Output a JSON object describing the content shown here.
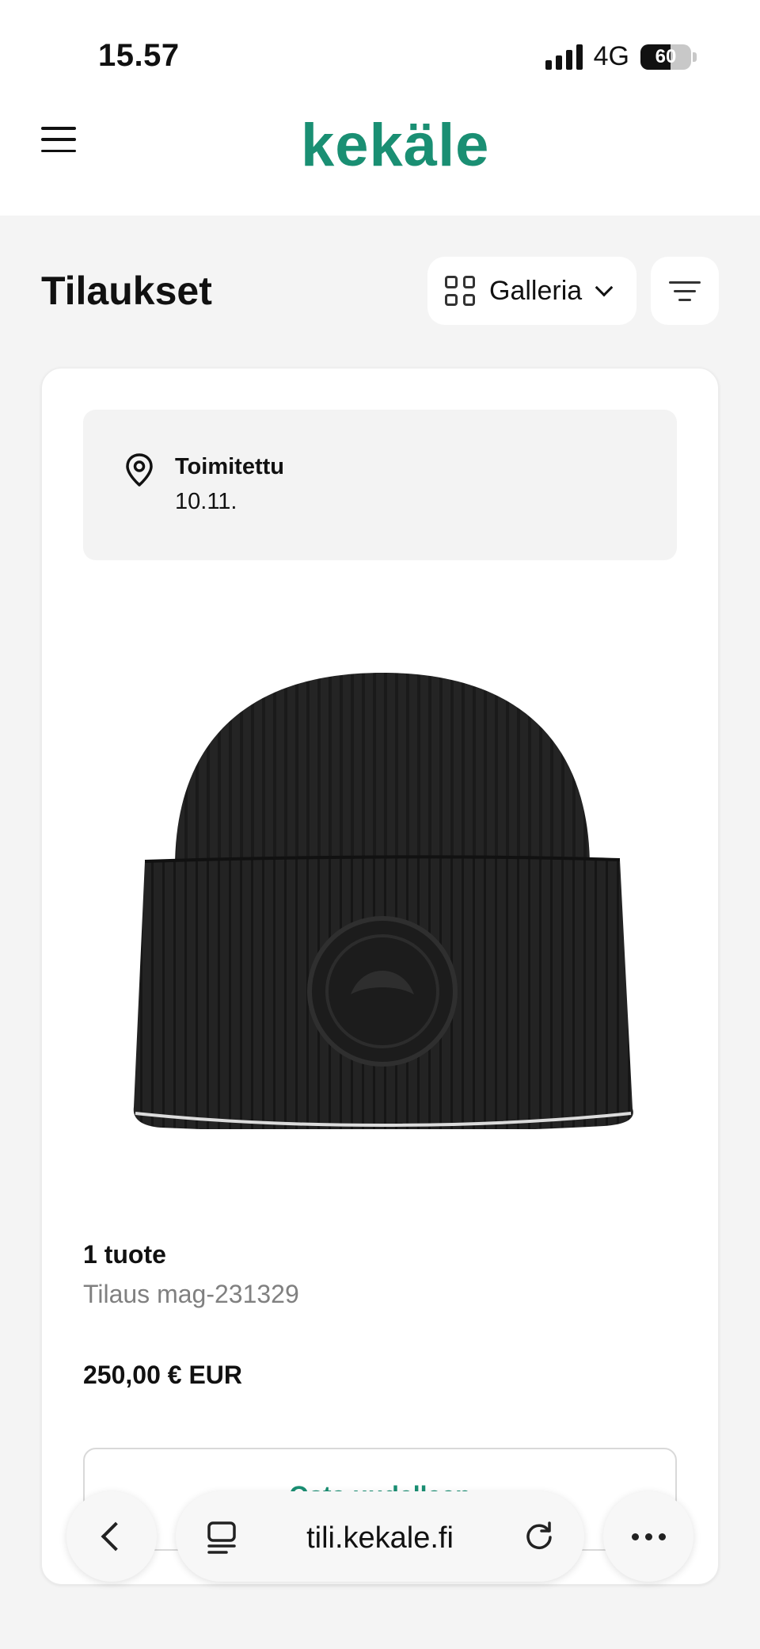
{
  "status_bar": {
    "time": "15.57",
    "network": "4G",
    "battery": "60",
    "icons": [
      "signal-icon",
      "battery-icon"
    ]
  },
  "header": {
    "logo_text": "kekäle",
    "brand_color": "#1a8f73",
    "menu_icon": "hamburger-menu-icon"
  },
  "toolbar": {
    "title": "Tilaukset",
    "view_label": "Galleria",
    "view_icon": "grid-icon",
    "filter_icon": "filter-icon"
  },
  "order": {
    "delivery_status": "Toimitettu",
    "delivery_date": "10.11.",
    "location_icon": "map-pin-icon",
    "product_image": "black knit beanie",
    "item_count": "1 tuote",
    "order_number": "Tilaus mag-231329",
    "price": "250,00 € EUR",
    "reorder_label": "Osta uudelleen"
  },
  "browser_bar": {
    "url": "tili.kekale.fi",
    "icons": [
      "back-icon",
      "tabs-icon",
      "reload-icon",
      "more-icon"
    ]
  }
}
